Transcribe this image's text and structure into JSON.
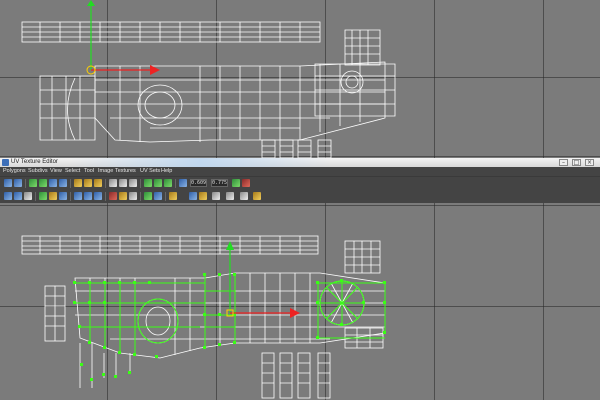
{
  "window": {
    "title": "UV Texture Editor",
    "controls": [
      "minimize-icon",
      "maximize-icon",
      "close-icon"
    ]
  },
  "menu": [
    "Polygons",
    "Subdivs",
    "View",
    "Select",
    "Tool",
    "Image",
    "Textures",
    "UV Sets",
    "Help"
  ],
  "toolbar": {
    "field_u": "0.609",
    "field_v": "0.775"
  },
  "colors": {
    "viewport_bg": "#7b7b7b",
    "wire": "#ffffff",
    "uv_selected": "#39ff14",
    "axis_y": "#22dd22",
    "axis_x": "#ee2222",
    "editor_bg": "#444444"
  }
}
